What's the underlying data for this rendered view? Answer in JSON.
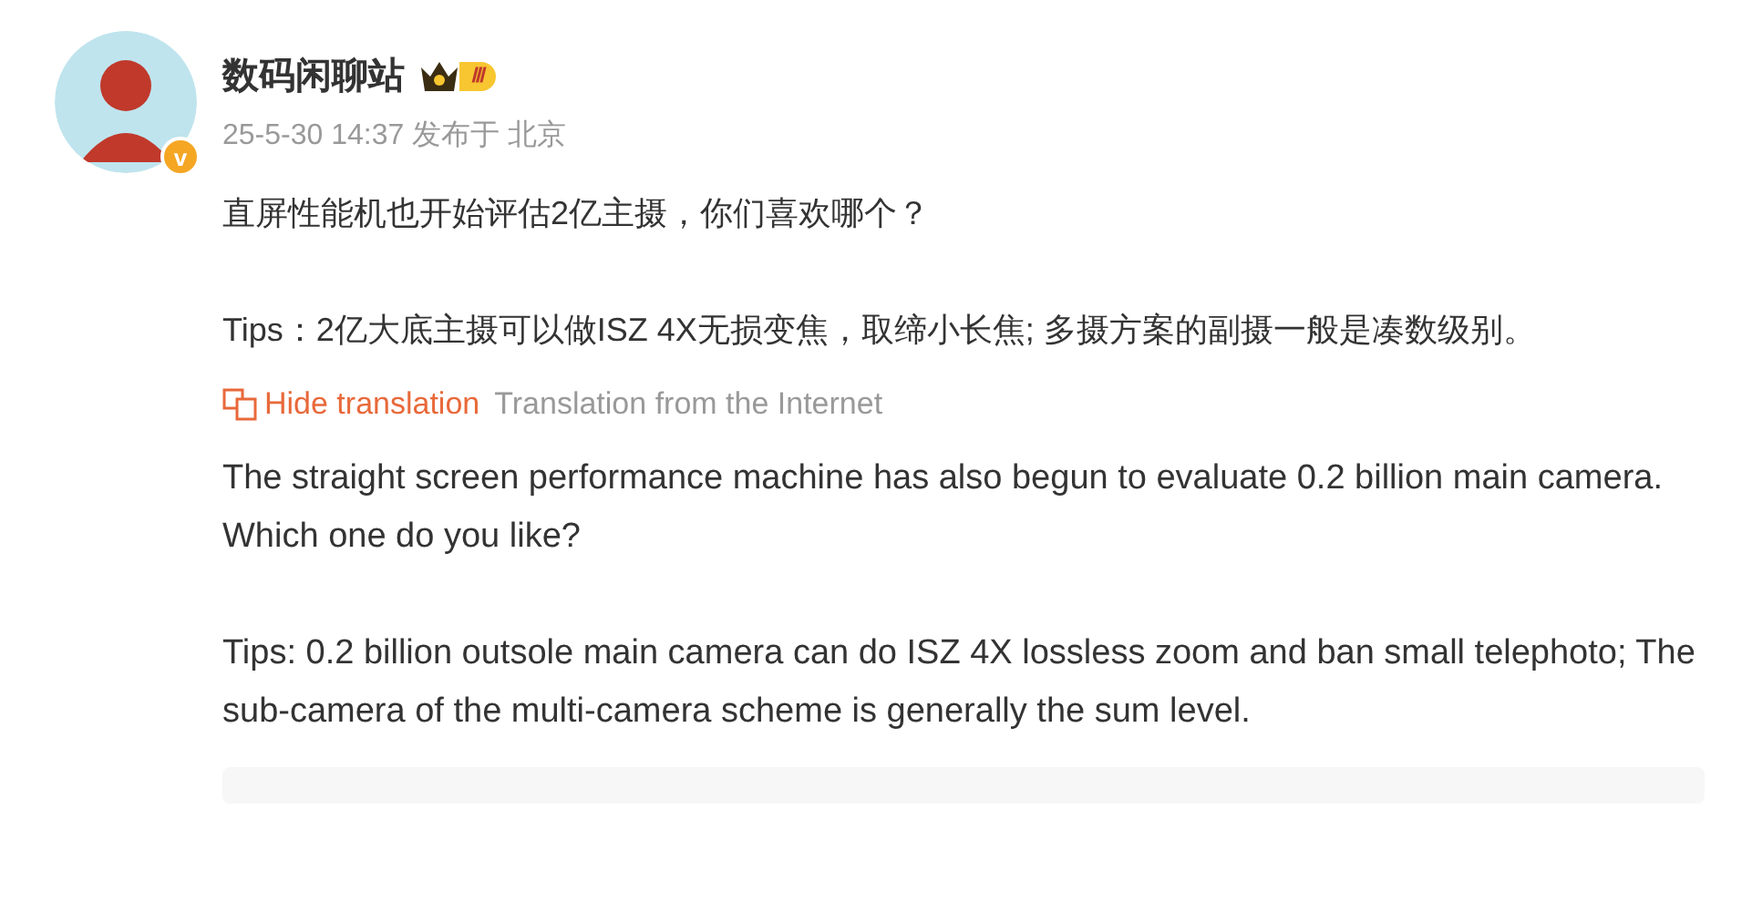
{
  "post": {
    "author": "数码闲聊站",
    "level_badge": "Ⅲ",
    "verified_badge": "v",
    "meta": "25-5-30 14:37 发布于 北京",
    "paragraphs": [
      "直屏性能机也开始评估2亿主摄，你们喜欢哪个？",
      "Tips：2亿大底主摄可以做ISZ 4X无损变焦，取缔小长焦; 多摄方案的副摄一般是凑数级别。"
    ],
    "translation": {
      "toggle": "Hide translation",
      "source": "Translation from the Internet",
      "paragraphs": [
        "The straight screen performance machine has also begun to evaluate 0.2 billion main camera. Which one do you like?",
        "Tips: 0.2 billion outsole main camera can do ISZ 4X lossless zoom and ban small telephoto; The sub-camera of the multi-camera scheme is generally the sum level."
      ]
    }
  }
}
